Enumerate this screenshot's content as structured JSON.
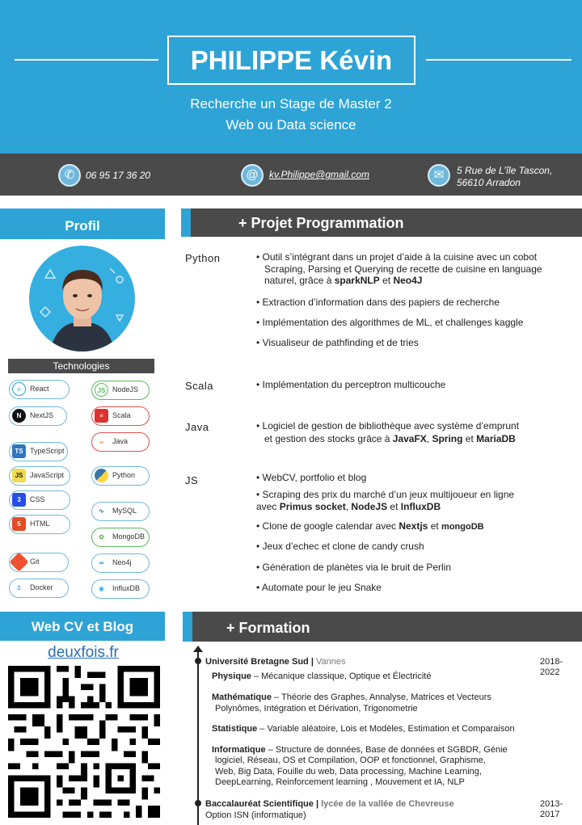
{
  "header": {
    "name": "PHILIPPE Kévin",
    "subtitle_line1": "Recherche un Stage de Master 2",
    "subtitle_line2": "Web ou Data science"
  },
  "contact": {
    "phone": "06 95 17 36 20",
    "email": "kv.Philippe@gmail.com",
    "address_line1": "5 Rue de L’île Tascon,",
    "address_line2": "56610 Arradon",
    "phone_icon": "phone-icon",
    "email_icon": "at-icon",
    "address_icon": "mail-icon"
  },
  "sidebar": {
    "profile_title": "Profil",
    "technologies_title": "Technologies",
    "technologies": [
      {
        "label": "React",
        "icon": "react-icon"
      },
      {
        "label": "NodeJS",
        "icon": "nodejs-icon"
      },
      {
        "label": "NextJS",
        "icon": "nextjs-icon"
      },
      {
        "label": "Scala",
        "icon": "scala-icon"
      },
      {
        "label": "Java",
        "icon": "java-icon"
      },
      {
        "label": "TypeScript",
        "icon": "typescript-icon"
      },
      {
        "label": "JavaScript",
        "icon": "javascript-icon"
      },
      {
        "label": "Python",
        "icon": "python-icon"
      },
      {
        "label": "CSS",
        "icon": "css-icon"
      },
      {
        "label": "HTML",
        "icon": "html-icon"
      },
      {
        "label": "MySQL",
        "icon": "mysql-icon"
      },
      {
        "label": "MongoDB",
        "icon": "mongodb-icon"
      },
      {
        "label": "Git",
        "icon": "git-icon"
      },
      {
        "label": "Neo4j",
        "icon": "neo4j-icon"
      },
      {
        "label": "Docker",
        "icon": "docker-icon"
      },
      {
        "label": "InfluxDB",
        "icon": "influxdb-icon"
      }
    ],
    "web_title": "Web CV et Blog",
    "web_link": "deuxfois.fr"
  },
  "projects": {
    "title": "+ Projet Programmation",
    "python": {
      "label": "Python",
      "item1_a": "• Outil s’intégrant  dans un projet  d’aide à la cuisine  avec un cobot",
      "item1_b": "Scraping,  Parsing et Querying de recette de cuisine  en language",
      "item1_c_pre": "naturel,  grâce  à ",
      "item1_c_b1": "sparkNLP",
      "item1_c_mid": " et ",
      "item1_c_b2": "Neo4J",
      "item2": "• Extraction  d’information  dans des papiers de recherche",
      "item3": "• Implémentation  des  algorithmes  de ML, et challenges  kaggle",
      "item4": "• Visualiseur  de pathfinding  et de  tries"
    },
    "scala": {
      "label": "Scala",
      "item1": "• Implémentation  du perceptron multicouche"
    },
    "java": {
      "label": "Java",
      "item1_a": "• Logiciel  de gestion de bibliothèque avec système  d’emprunt",
      "item1_b_pre": "et gestion des stocks grâce à ",
      "item1_b_b1": "JavaFX",
      "item1_b_s1": ", ",
      "item1_b_b2": "Spring",
      "item1_b_s2": " et ",
      "item1_b_b3": "MariaDB"
    },
    "js": {
      "label": "JS",
      "item1": "• WebCV,  portfolio  et blog",
      "item2_a": "• Scraping  des prix du marché d’un jeux multijoueur  en ligne",
      "item2_b_pre": "avec ",
      "item2_b_b1": "Primus socket",
      "item2_b_s1": ", ",
      "item2_b_b2": "NodeJS",
      "item2_b_s2": " et ",
      "item2_b_b3": "InfluxDB",
      "item3_pre": "• Clone de google  calendar  avec  ",
      "item3_b1": "Nextjs",
      "item3_mid": " et ",
      "item3_b2": "mongoDB",
      "item4": "• Jeux d’echec et clone de candy crush",
      "item5": "• Génération  de planètes via le bruit de Perlin",
      "item6": "• Automate  pour le jeu Snake"
    }
  },
  "formation": {
    "title": "+ Formation",
    "uni_name": "Université Bretagne Sud",
    "uni_sep": " | ",
    "uni_city": "Vannes",
    "uni_dates": "2018-2022",
    "physique_k": "Physique",
    "physique_v": " – Mécanique classique, Optique et Électricité",
    "math_k": "Mathématique",
    "math_v1": " – Théorie des Graphes, Annalyse, Matrices et Vecteurs",
    "math_v2": "Polynômes, Intégration et  Dérivation, Trigonometrie",
    "stat_k": "Statistique",
    "stat_v": " – Variable aléatoire, Lois et Modèles, Estimation et Comparaison",
    "info_k": "Informatique",
    "info_v1": " – Structure de données, Base de données et SGBDR, Génie",
    "info_v2": "logiciel, Réseau, OS et Compilation, OOP et fonctionnel, Graphisme,",
    "info_v3": "Web, Big Data, Fouille du web, Data processing, Machine Learning,",
    "info_v4": "DeepLearning, Reinforcement learning , Mouvement et IA, NLP",
    "bac_name": "Baccalauréat Scientifique",
    "bac_sep": " | ",
    "bac_school": "lycée de la vallée de Chevreuse",
    "bac_dates": "2013-2017",
    "bac_option": "Option ISN (informatique)"
  }
}
